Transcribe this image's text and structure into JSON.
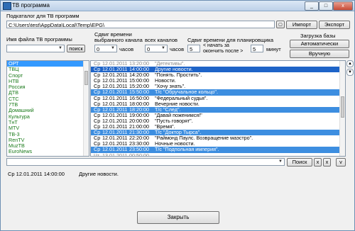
{
  "window": {
    "title": "ТВ программа",
    "controls": [
      "_",
      "□",
      "x"
    ]
  },
  "folder": {
    "label": "Подкаталог для ТВ программ",
    "path": "C:\\Users\\test\\AppData\\Local\\Temp\\EPG\\",
    "import_label": "Импорт",
    "export_label": "Экспорт"
  },
  "filename": {
    "label": "Имя файла ТВ программы",
    "value": "",
    "search_label": "поиск"
  },
  "shift": {
    "selected_label_line1": "Сдвиг времени",
    "selected_label_line2": "выбранного канала",
    "selected_value": "0",
    "selected_unit": "часов",
    "all_label": "всех каналов",
    "all_value": "0",
    "all_unit": "часов",
    "plan_label": "Сдвиг времени для планировщика",
    "plan_start_value": "5",
    "plan_start_label_line1": "< начать за",
    "plan_start_label_line2": "окончить после >",
    "plan_end_value": "5",
    "plan_end_unit": "минут"
  },
  "base": {
    "load_label": "Загрузка базы",
    "auto_label": "Автоматически",
    "manual_label": "Вручную"
  },
  "channels": [
    "ОРТ",
    "ТВЦ",
    "Спорт",
    "НТВ",
    "Россия",
    "ДТВ",
    "СТС",
    "7ТВ",
    "Домашний",
    "Культура",
    "ТнТ",
    "MTV",
    "ТВ-3",
    "RenTV",
    "MuzTB",
    "EuroNews"
  ],
  "selected_channel_index": 0,
  "programs": [
    {
      "day": "Ср",
      "date": "12.01.2011",
      "time": "13:20:00",
      "title": "\"Детективы\".",
      "style": "gray"
    },
    {
      "day": "Ср",
      "date": "12.01.2011",
      "time": "14:00:00",
      "title": "Другие новости.",
      "style": "cur"
    },
    {
      "day": "Ср",
      "date": "12.01.2011",
      "time": "14:20:00",
      "title": "\"Понять. Простить\".",
      "style": "normal"
    },
    {
      "day": "Ср",
      "date": "12.01.2011",
      "time": "15:00:00",
      "title": "Новости.",
      "style": "normal"
    },
    {
      "day": "Ср",
      "date": "12.01.2011",
      "time": "15:20:00",
      "title": "\"Хочу знать\".",
      "style": "normal"
    },
    {
      "day": "Ср",
      "date": "12.01.2011",
      "time": "15:50:00",
      "title": "Т/с \"Обручальное кольцо\".",
      "style": "hl"
    },
    {
      "day": "Ср",
      "date": "12.01.2011",
      "time": "16:50:00",
      "title": "\"Федеральный судья\".",
      "style": "normal"
    },
    {
      "day": "Ср",
      "date": "12.01.2011",
      "time": "18:00:00",
      "title": "Вечерние новости.",
      "style": "normal"
    },
    {
      "day": "Ср",
      "date": "12.01.2011",
      "time": "18:20:00",
      "title": "Т/с \"След\".",
      "style": "hl"
    },
    {
      "day": "Ср",
      "date": "12.01.2011",
      "time": "19:00:00",
      "title": "\"Давай поженимся!\"",
      "style": "normal"
    },
    {
      "day": "Ср",
      "date": "12.01.2011",
      "time": "20:00:00",
      "title": "\"Пусть говорят\".",
      "style": "normal"
    },
    {
      "day": "Ср",
      "date": "12.01.2011",
      "time": "21:00:00",
      "title": "\"Время\".",
      "style": "normal"
    },
    {
      "day": "Ср",
      "date": "12.01.2011",
      "time": "21:30:00",
      "title": "Т/с \"Доктор Тырса\".",
      "style": "hl"
    },
    {
      "day": "Ср",
      "date": "12.01.2011",
      "time": "22:20:00",
      "title": "\"Раймонд Паулс. Возвращение маэстро\".",
      "style": "normal"
    },
    {
      "day": "Ср",
      "date": "12.01.2011",
      "time": "23:30:00",
      "title": "Ночные новости.",
      "style": "normal"
    },
    {
      "day": "Ср",
      "date": "12.01.2011",
      "time": "23:50:00",
      "title": "Т/с \"Подпольная империя\".",
      "style": "hl"
    },
    {
      "day": "Чт",
      "date": "13.01.2011",
      "time": "00:50:00",
      "title": "...",
      "style": "gray"
    }
  ],
  "search": {
    "value": "",
    "search_label": "Поиск",
    "clear_label": "x",
    "close_label": "x",
    "more_label": "v"
  },
  "details": {
    "datetime": "Ср 12.01.2011   14:00:00",
    "title": "Другие новости."
  },
  "close_label": "Закрыть"
}
